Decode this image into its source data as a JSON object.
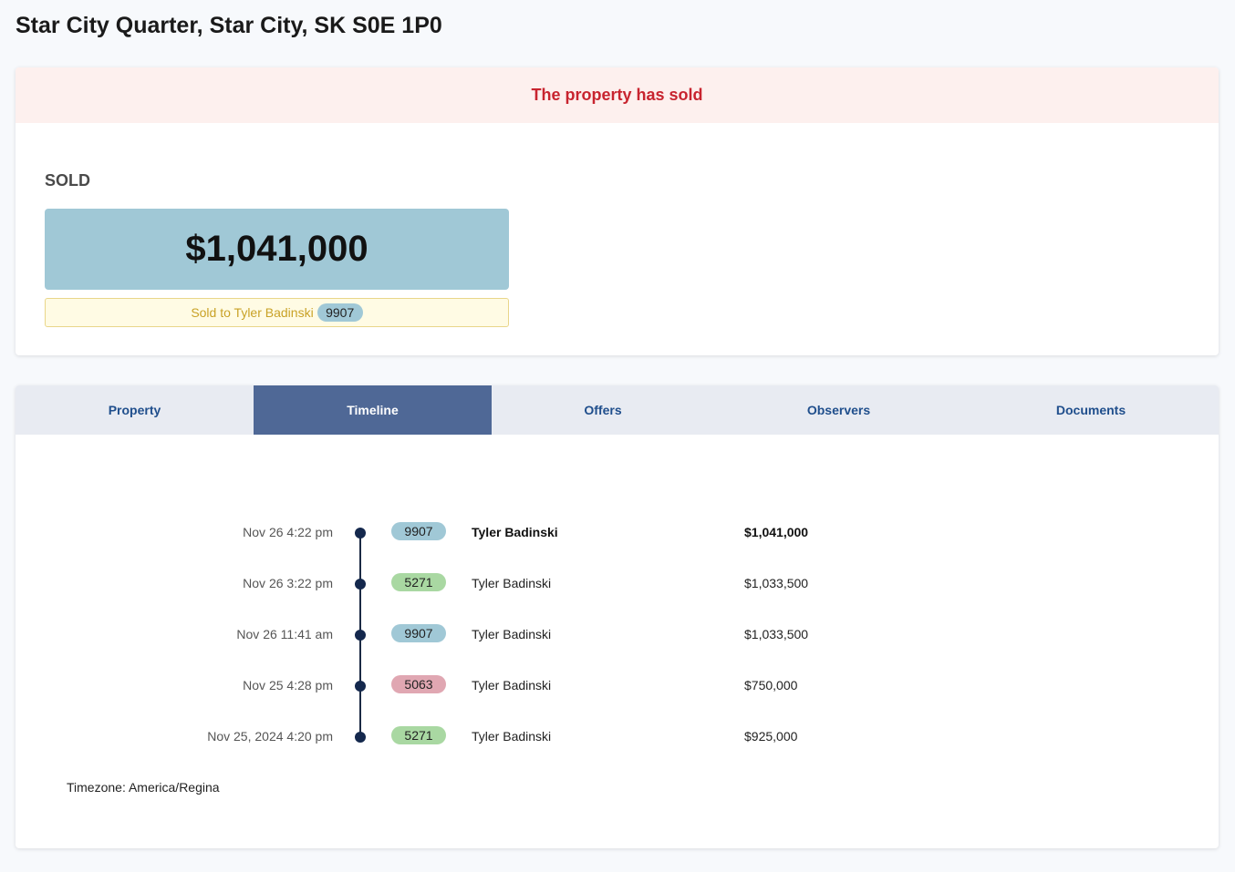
{
  "page": {
    "title": "Star City Quarter, Star City, SK S0E 1P0"
  },
  "status": {
    "banner": "The property has sold",
    "label": "SOLD",
    "price": "$1,041,000",
    "buyer_text": "Sold to Tyler Badinski",
    "buyer_id": "9907"
  },
  "tabs": [
    {
      "label": "Property",
      "active": false
    },
    {
      "label": "Timeline",
      "active": true
    },
    {
      "label": "Offers",
      "active": false
    },
    {
      "label": "Observers",
      "active": false
    },
    {
      "label": "Documents",
      "active": false
    }
  ],
  "timeline": {
    "entries": [
      {
        "time": "Nov 26 4:22 pm",
        "id": "9907",
        "id_color": "blue",
        "name": "Tyler Badinski",
        "amount": "$1,041,000",
        "highlight": true
      },
      {
        "time": "Nov 26 3:22 pm",
        "id": "5271",
        "id_color": "green",
        "name": "Tyler Badinski",
        "amount": "$1,033,500",
        "highlight": false
      },
      {
        "time": "Nov 26 11:41 am",
        "id": "9907",
        "id_color": "blue",
        "name": "Tyler Badinski",
        "amount": "$1,033,500",
        "highlight": false
      },
      {
        "time": "Nov 25 4:28 pm",
        "id": "5063",
        "id_color": "pink",
        "name": "Tyler Badinski",
        "amount": "$750,000",
        "highlight": false
      },
      {
        "time": "Nov 25, 2024 4:20 pm",
        "id": "5271",
        "id_color": "green",
        "name": "Tyler Badinski",
        "amount": "$925,000",
        "highlight": false
      }
    ],
    "timezone": "Timezone: America/Regina"
  },
  "colors": {
    "blue": "#a0c8d6",
    "green": "#a9d8a2",
    "pink": "#e0a7b2",
    "active_tab": "#4f6896",
    "sold_red": "#c8242f"
  }
}
